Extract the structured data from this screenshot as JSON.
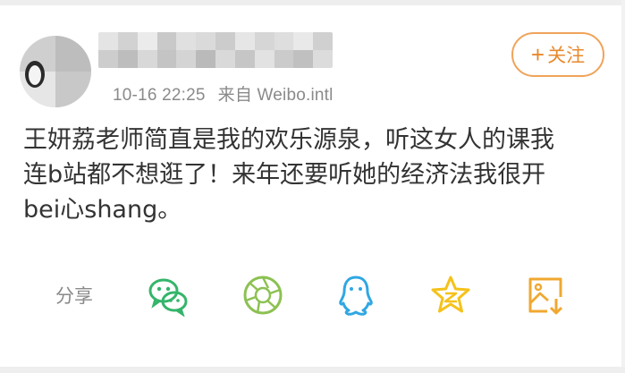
{
  "post": {
    "time": "10-16 22:25",
    "source": "来自 Weibo.intl",
    "text_line1": "王妍荔老师简直是我的欢乐源泉，听这女人的课我",
    "text_line2": "连b站都不想逛了！来年还要听她的经济法我很开",
    "text_line3": "bei心shang。"
  },
  "follow": {
    "plus": "+",
    "label": "关注"
  },
  "share": {
    "label": "分享",
    "targets": [
      "wechat-icon",
      "moments-icon",
      "qq-icon",
      "qzone-icon",
      "save-image-icon"
    ]
  },
  "colors": {
    "wechat": "#34b56a",
    "moments": "#8cc152",
    "qq": "#2fa7e3",
    "qzone": "#f5c21b",
    "save": "#f0a830",
    "follow": "#e8892c"
  }
}
